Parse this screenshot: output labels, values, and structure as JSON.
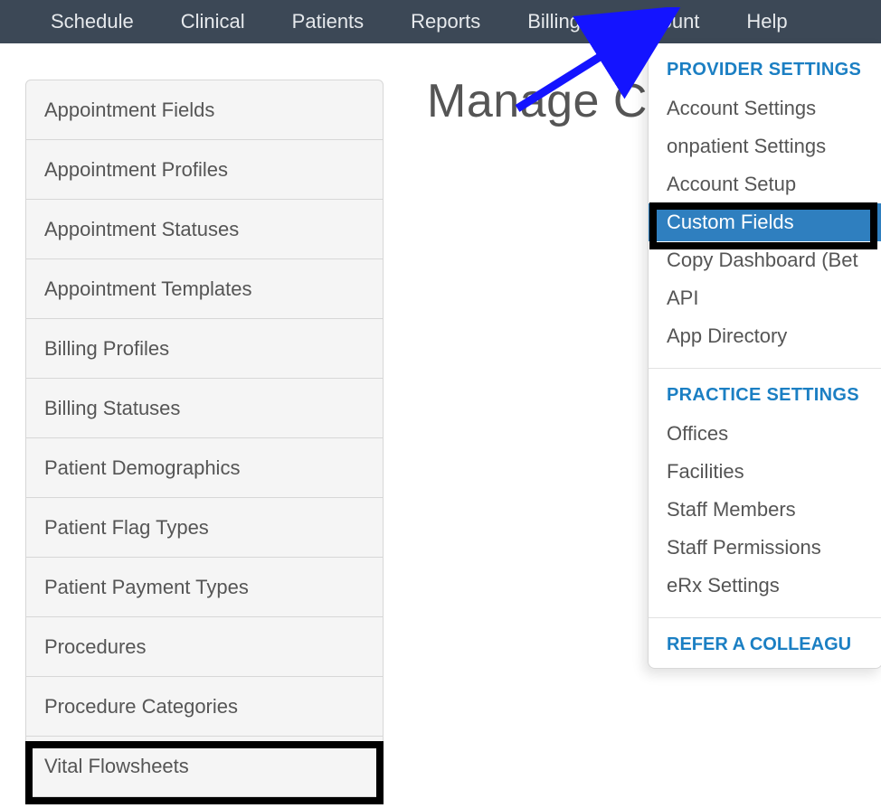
{
  "topnav": {
    "items": [
      {
        "label": "Schedule"
      },
      {
        "label": "Clinical"
      },
      {
        "label": "Patients"
      },
      {
        "label": "Reports"
      },
      {
        "label": "Billing"
      },
      {
        "label": "Account"
      },
      {
        "label": "Help"
      }
    ]
  },
  "page_title_partial": "Manage C",
  "sidebar": {
    "items": [
      {
        "label": "Appointment Fields"
      },
      {
        "label": "Appointment Profiles"
      },
      {
        "label": "Appointment Statuses"
      },
      {
        "label": "Appointment Templates"
      },
      {
        "label": "Billing Profiles"
      },
      {
        "label": "Billing Statuses"
      },
      {
        "label": "Patient Demographics"
      },
      {
        "label": "Patient Flag Types"
      },
      {
        "label": "Patient Payment Types"
      },
      {
        "label": "Procedures"
      },
      {
        "label": "Procedure Categories"
      },
      {
        "label": "Vital Flowsheets"
      }
    ]
  },
  "dropdown": {
    "section1_header": "PROVIDER SETTINGS",
    "section1_items": [
      {
        "label": "Account Settings",
        "selected": false
      },
      {
        "label": "onpatient Settings",
        "selected": false
      },
      {
        "label": "Account Setup",
        "selected": false
      },
      {
        "label": "Custom Fields",
        "selected": true
      },
      {
        "label": "Copy Dashboard (Bet",
        "selected": false
      },
      {
        "label": "API",
        "selected": false
      },
      {
        "label": "App Directory",
        "selected": false
      }
    ],
    "section2_header": "PRACTICE SETTINGS",
    "section2_items": [
      {
        "label": "Offices"
      },
      {
        "label": "Facilities"
      },
      {
        "label": "Staff Members"
      },
      {
        "label": "Staff Permissions"
      },
      {
        "label": "eRx Settings"
      }
    ],
    "refer_link": "REFER A COLLEAGU"
  },
  "colors": {
    "nav_bg": "#3c4856",
    "link_blue": "#1b7fc3",
    "selected_bg": "#2f7fbf",
    "annotation_arrow": "#1414ff"
  }
}
